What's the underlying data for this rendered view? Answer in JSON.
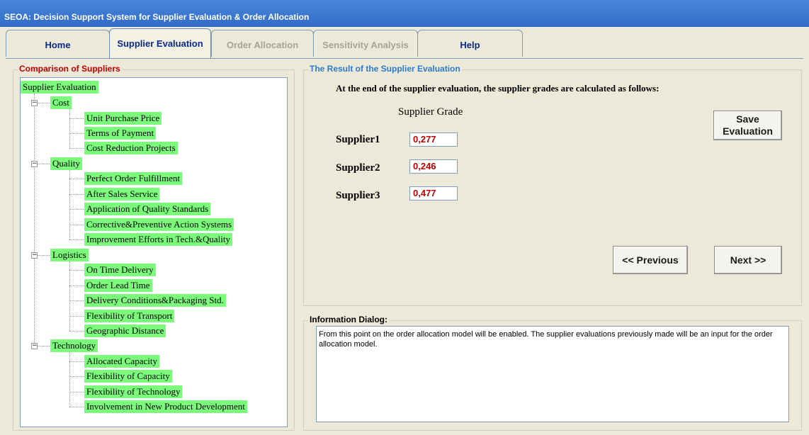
{
  "window": {
    "title": "SEOA: Decision Support System for Supplier Evaluation & Order Allocation"
  },
  "tabs": [
    {
      "label": "Home",
      "state": "normal"
    },
    {
      "label": "Supplier Evaluation",
      "state": "active"
    },
    {
      "label": "Order Allocation",
      "state": "disabled"
    },
    {
      "label": "Sensitivity Analysis",
      "state": "disabled"
    },
    {
      "label": "Help",
      "state": "normal"
    }
  ],
  "comparison": {
    "title": "Comparison of Suppliers",
    "title_color": "#c00000",
    "root": "Supplier Evaluation",
    "criteria": [
      {
        "label": "Cost",
        "expanded": true,
        "children": [
          "Unit Purchase Price",
          "Terms of Payment",
          "Cost Reduction Projects"
        ]
      },
      {
        "label": "Quality",
        "expanded": true,
        "children": [
          "Perfect Order Fulfillment",
          "After Sales Service",
          "Application of Quality Standards",
          "Corrective&Preventive Action Systems",
          "Improvement Efforts in Tech.&Quality"
        ]
      },
      {
        "label": "Logistics",
        "expanded": true,
        "children": [
          "On Time Delivery",
          "Order Lead Time",
          "Delivery Conditions&Packaging Std.",
          "Flexibility of Transport",
          "Geographic Distance"
        ]
      },
      {
        "label": "Technology",
        "expanded": true,
        "children": [
          "Allocated Capacity",
          "Flexibility of Capacity",
          "Flexibility of Technology",
          "Involvement in New Product Development"
        ]
      }
    ],
    "highlight_color": "#7cfa7c",
    "expander_icon": "minus"
  },
  "result": {
    "title": "The Result of the Supplier Evaluation",
    "title_color": "#2a7bd0",
    "intro": "At the end of the supplier evaluation, the supplier grades are calculated as follows:",
    "grade_header": "Supplier Grade",
    "suppliers": [
      {
        "name": "Supplier1",
        "grade": "0,277"
      },
      {
        "name": "Supplier2",
        "grade": "0,246"
      },
      {
        "name": "Supplier3",
        "grade": "0,477"
      }
    ],
    "grade_color": "#c00000",
    "save_label_line1": "Save",
    "save_label_line2": "Evaluation",
    "previous_label": "<< Previous",
    "next_label": "Next >>"
  },
  "info": {
    "title": "Information Dialog:",
    "text": "From this point on the order allocation model will be enabled. The supplier evaluations previously made will be an input for the order allocation model."
  }
}
